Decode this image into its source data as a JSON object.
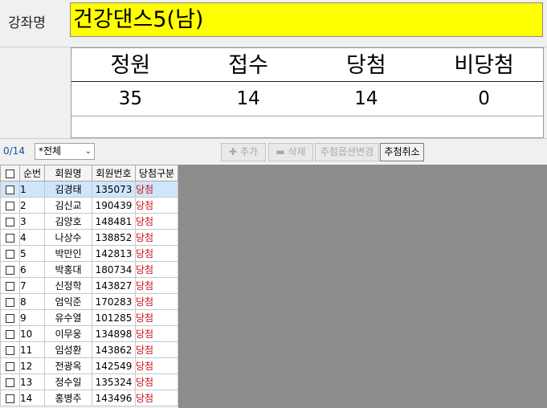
{
  "course": {
    "label": "강좌명",
    "name": "건강댄스5(남)"
  },
  "summary": {
    "headers": [
      "정원",
      "접수",
      "당첨",
      "비당첨"
    ],
    "values": [
      "35",
      "14",
      "14",
      "0"
    ]
  },
  "toolbar": {
    "count": "0/14",
    "filter_value": "*전체",
    "add_label": "추가",
    "delete_label": "삭제",
    "change_option_label": "추첨옵션변경",
    "cancel_draw_label": "추첨취소"
  },
  "grid": {
    "columns": [
      "순번",
      "회원명",
      "회원번호",
      "당첨구분"
    ],
    "rows": [
      {
        "no": "1",
        "name": "김경태",
        "id": "135073",
        "status": "당첨"
      },
      {
        "no": "2",
        "name": "김신교",
        "id": "190439",
        "status": "당첨"
      },
      {
        "no": "3",
        "name": "김양호",
        "id": "148481",
        "status": "당첨"
      },
      {
        "no": "4",
        "name": "나상수",
        "id": "138852",
        "status": "당첨"
      },
      {
        "no": "5",
        "name": "박만인",
        "id": "142813",
        "status": "당첨"
      },
      {
        "no": "6",
        "name": "박홍대",
        "id": "180734",
        "status": "당첨"
      },
      {
        "no": "7",
        "name": "신정학",
        "id": "143827",
        "status": "당첨"
      },
      {
        "no": "8",
        "name": "엄익준",
        "id": "170283",
        "status": "당첨"
      },
      {
        "no": "9",
        "name": "유수열",
        "id": "101285",
        "status": "당첨"
      },
      {
        "no": "10",
        "name": "이무웅",
        "id": "134898",
        "status": "당첨"
      },
      {
        "no": "11",
        "name": "임성환",
        "id": "143862",
        "status": "당첨"
      },
      {
        "no": "12",
        "name": "전광옥",
        "id": "142549",
        "status": "당첨"
      },
      {
        "no": "13",
        "name": "정수일",
        "id": "135324",
        "status": "당첨"
      },
      {
        "no": "14",
        "name": "홍병주",
        "id": "143496",
        "status": "당첨"
      }
    ]
  },
  "colors": {
    "course_bg": "#ffff00",
    "status_text": "#d01010",
    "selected_row": "#cfe5fb",
    "grid_empty": "#8c8c8c"
  }
}
